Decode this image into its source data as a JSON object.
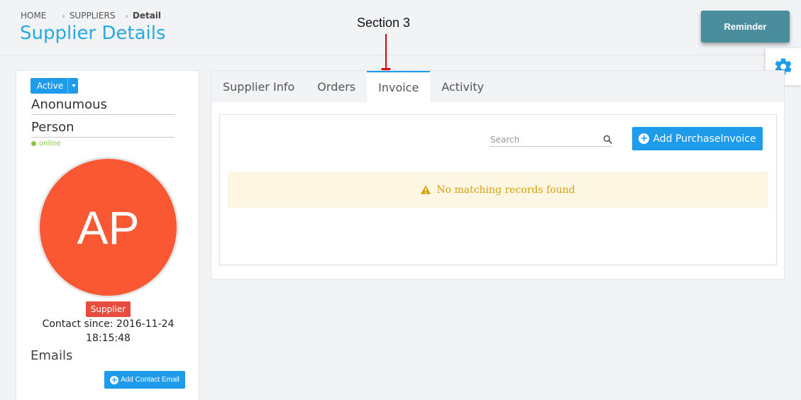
{
  "header": {
    "breadcrumb": {
      "home": "HOME",
      "suppliers": "SUPPLIERS",
      "current": "Detail"
    },
    "title": "Supplier Details",
    "reminder_label": "Reminder"
  },
  "annotation": {
    "label": "Section 3",
    "color": "#e00000"
  },
  "sidebar": {
    "status": "Active",
    "first_name": "Anonumous",
    "last_name": "Person",
    "online_label": "online",
    "avatar_initials": "AP",
    "avatar_color": "#fa5733",
    "role_badge": "Supplier",
    "contact_since_line1": "Contact since: 2016-11-24",
    "contact_since_line2": "18:15:48",
    "emails_heading": "Emails",
    "add_email_label": "Add Contact Email"
  },
  "tabs": [
    {
      "label": "Supplier Info",
      "active": false
    },
    {
      "label": "Orders",
      "active": false
    },
    {
      "label": "Invoice",
      "active": true
    },
    {
      "label": "Activity",
      "active": false
    }
  ],
  "invoice": {
    "search_placeholder": "Search",
    "add_label": "Add PurchaseInvoice",
    "empty_message": "No matching records found"
  },
  "colors": {
    "accent": "#1e9bea",
    "title": "#2aa9e0",
    "warning": "#d6a10a",
    "danger": "#e84c3d",
    "reminder": "#4a8e9e"
  }
}
